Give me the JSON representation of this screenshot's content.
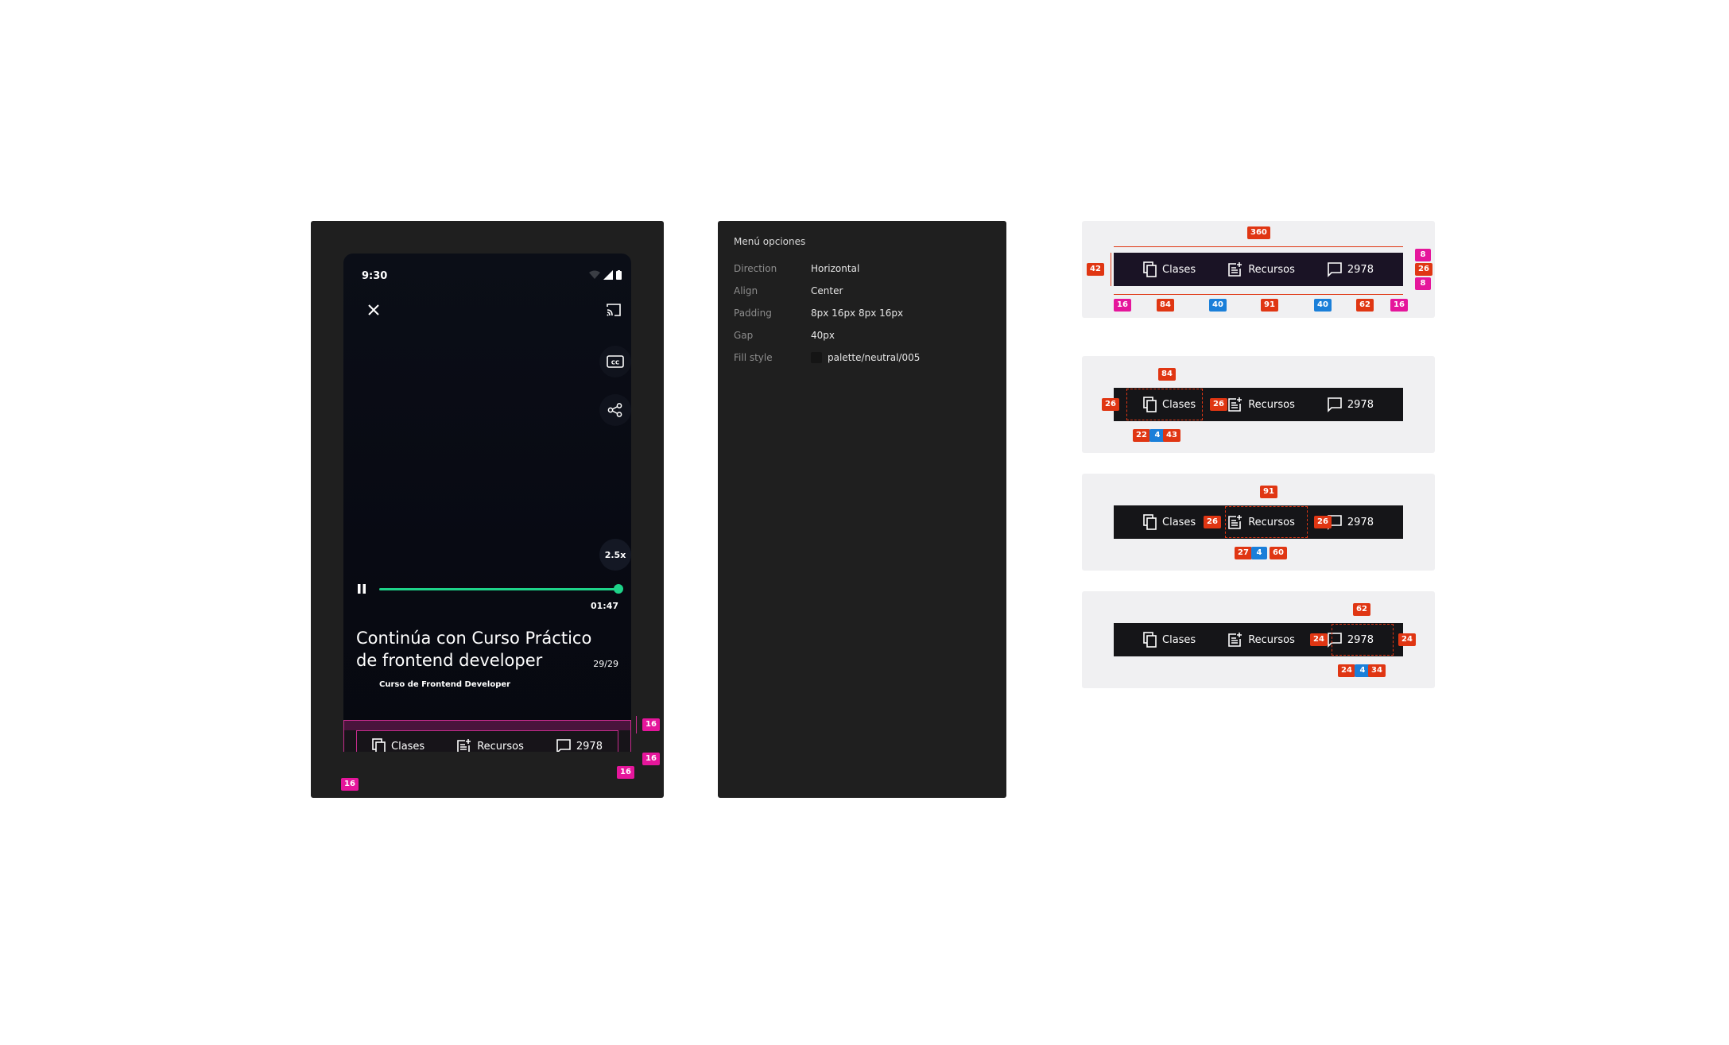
{
  "phone": {
    "status_time": "9:30",
    "speed": "2.5x",
    "elapsed": "01:47",
    "progress": 1.0,
    "title": "Continúa con Curso Práctico de frontend developer",
    "counter": "29/29",
    "course": "Curso de Frontend Developer"
  },
  "menu": {
    "items": [
      {
        "label": "Clases"
      },
      {
        "label": "Recursos"
      },
      {
        "label": "2978"
      }
    ]
  },
  "specs": {
    "spacing": {
      "top": "16",
      "bottom": "16",
      "left": "16",
      "right": "16"
    }
  },
  "props": {
    "title": "Menú opciones",
    "rows": [
      {
        "label": "Direction",
        "value": "Horizontal"
      },
      {
        "label": "Align",
        "value": "Center"
      },
      {
        "label": "Padding",
        "value": "8px 16px 8px 16px"
      },
      {
        "label": "Gap",
        "value": "40px"
      },
      {
        "label": "Fill style",
        "value": "palette/neutral/005"
      }
    ]
  },
  "variants": {
    "v1": {
      "width": "360",
      "height": "42",
      "pad_left": "16",
      "item1": "84",
      "gap1": "40",
      "item2": "91",
      "gap2": "40",
      "item3": "62",
      "pad_right": "16",
      "pad_top": "8",
      "inner": "26",
      "pad_bottom": "8"
    },
    "v2": {
      "width": "84",
      "left": "26",
      "right": "26",
      "icon": "22",
      "gap": "4",
      "text": "43"
    },
    "v3": {
      "width": "91",
      "left": "26",
      "right": "26",
      "icon": "27",
      "gap": "4",
      "text": "60"
    },
    "v4": {
      "width": "62",
      "left": "24",
      "right": "24",
      "icon": "24",
      "gap": "4",
      "text": "34"
    }
  },
  "colors": {
    "accent": "#1ed389",
    "spec_pink": "#e5169b",
    "spec_red": "#e03613",
    "spec_blue": "#1a7fd9"
  }
}
